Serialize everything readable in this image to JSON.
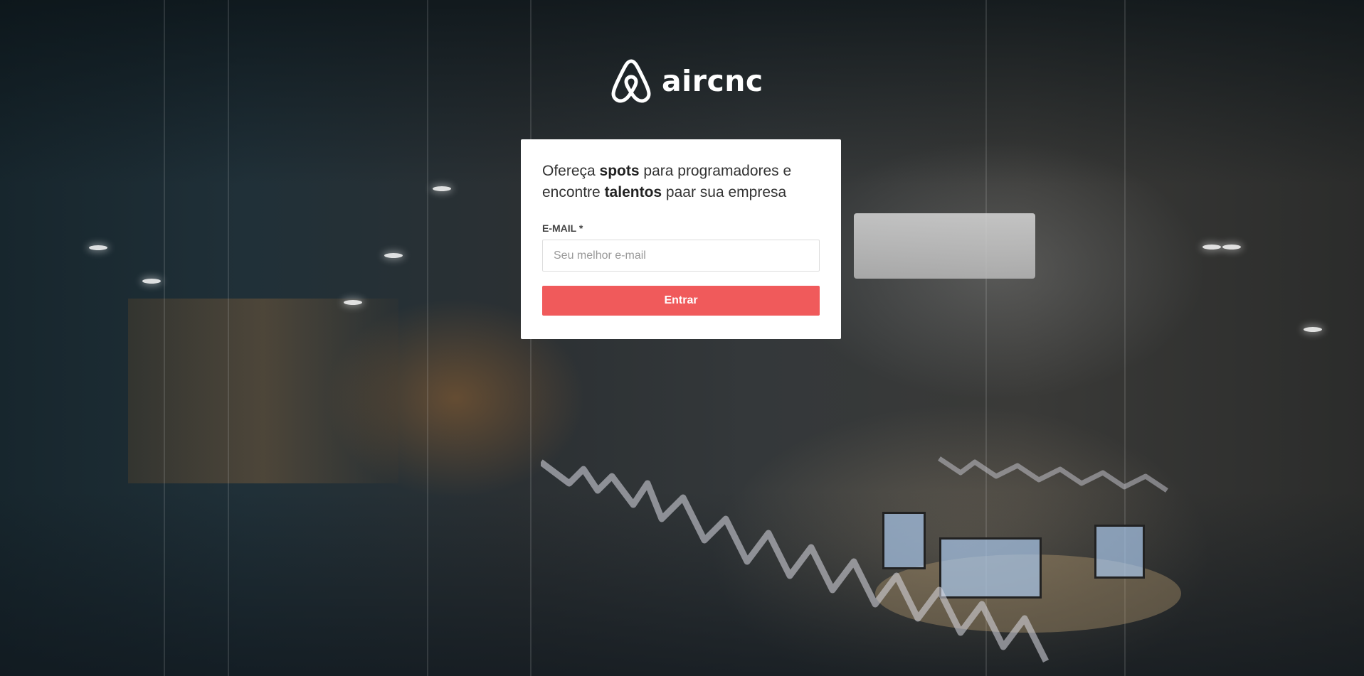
{
  "brand": {
    "name": "aircnc",
    "logo_icon": "airbnb-belo-icon",
    "text_color": "#ffffff"
  },
  "background": {
    "description_icon": "office-meeting-room-photo"
  },
  "login_card": {
    "headline": {
      "part1": "Ofereça ",
      "bold1": "spots",
      "part2": " para programadores e encontre ",
      "bold2": "talentos",
      "part3": " paar sua empresa"
    },
    "email": {
      "label": "E-MAIL *",
      "placeholder": "Seu melhor e-mail",
      "value": ""
    },
    "submit_label": "Entrar"
  },
  "colors": {
    "accent": "#f05a5b",
    "card_bg": "#ffffff",
    "label": "#444444",
    "input_border": "#dddddd"
  }
}
